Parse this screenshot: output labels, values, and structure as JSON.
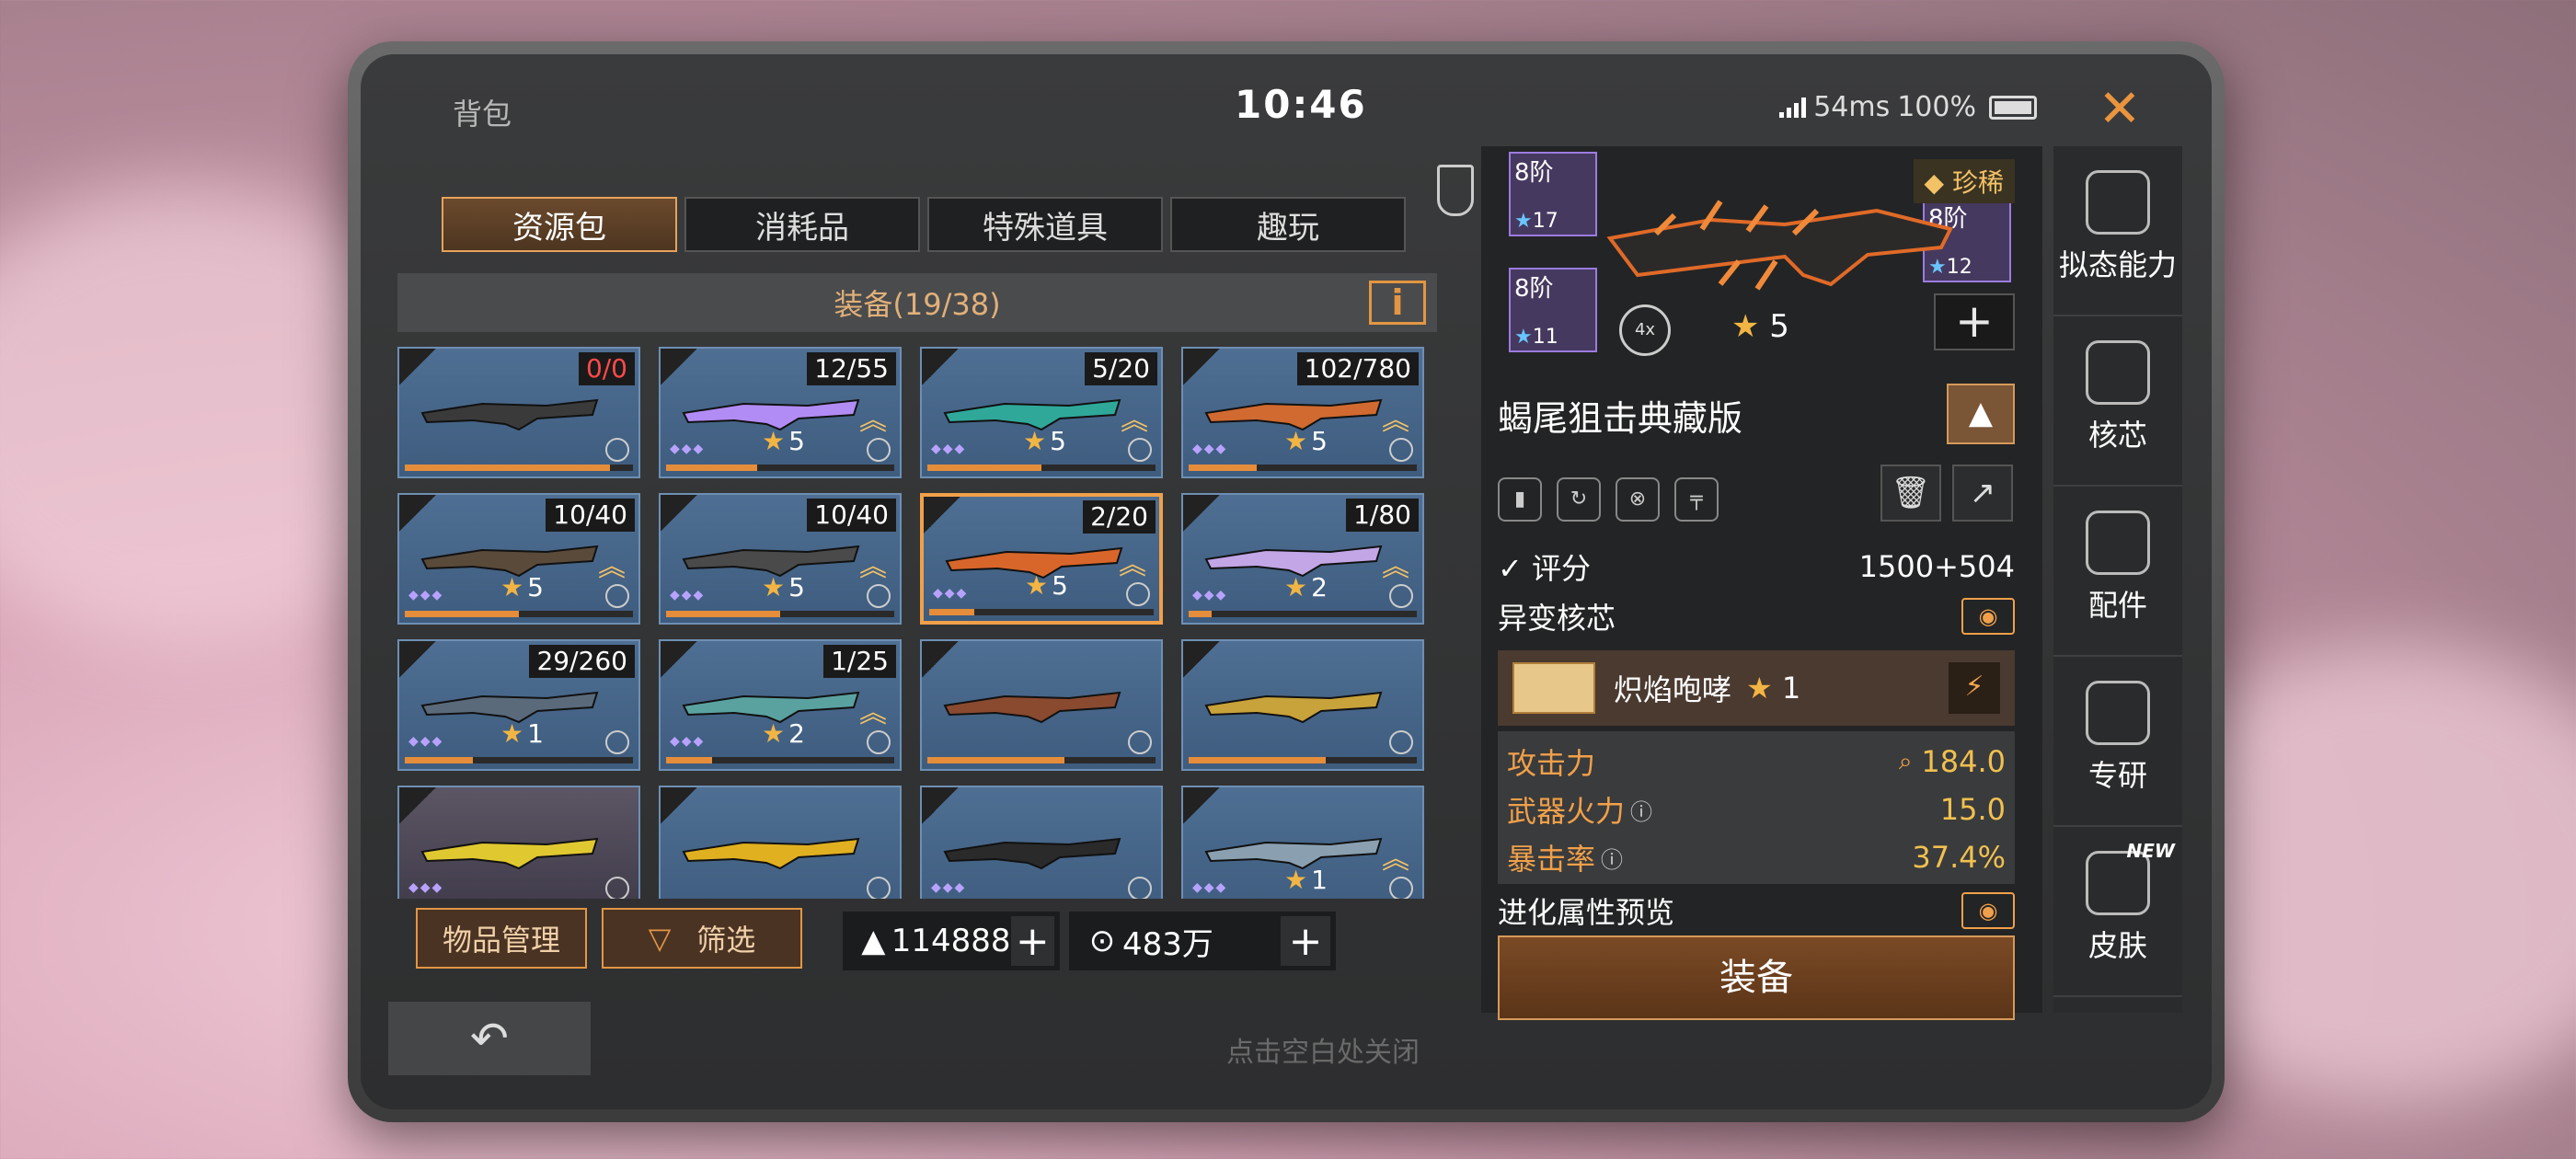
{
  "header": {
    "title": "背包",
    "time": "10:46",
    "ping": "54ms",
    "battery": "100%",
    "close_icon": "close-icon"
  },
  "tabs": [
    {
      "label": "资源包",
      "active": true
    },
    {
      "label": "消耗品",
      "active": false
    },
    {
      "label": "特殊道具",
      "active": false
    },
    {
      "label": "趣玩",
      "active": false
    }
  ],
  "section": {
    "title": "装备(19/38)",
    "info_label": "i"
  },
  "items": [
    {
      "count": "0/0",
      "count_red": true,
      "stars": "",
      "chevron": false,
      "dots": false,
      "progress": 0.9
    },
    {
      "count": "12/55",
      "stars": "5",
      "chevron": true,
      "dots": true,
      "progress": 0.4
    },
    {
      "count": "5/20",
      "stars": "5",
      "chevron": true,
      "dots": true,
      "progress": 0.5
    },
    {
      "count": "102/780",
      "stars": "5",
      "chevron": true,
      "dots": true,
      "progress": 0.3
    },
    {
      "count": "10/40",
      "stars": "5",
      "chevron": true,
      "dots": true,
      "progress": 0.5
    },
    {
      "count": "10/40",
      "stars": "5",
      "chevron": true,
      "dots": true,
      "progress": 0.5
    },
    {
      "count": "2/20",
      "stars": "5",
      "chevron": true,
      "dots": true,
      "progress": 0.2,
      "selected": true
    },
    {
      "count": "1/80",
      "stars": "2",
      "chevron": true,
      "dots": true,
      "progress": 0.1
    },
    {
      "count": "29/260",
      "stars": "1",
      "chevron": false,
      "dots": true,
      "progress": 0.3
    },
    {
      "count": "1/25",
      "stars": "2",
      "chevron": true,
      "dots": true,
      "progress": 0.2
    },
    {
      "count": "",
      "stars": "",
      "chevron": false,
      "dots": false,
      "progress": 0.6
    },
    {
      "count": "",
      "stars": "",
      "chevron": false,
      "dots": false,
      "progress": 0.6
    },
    {
      "count": "",
      "stars": "",
      "chevron": false,
      "dots": true,
      "progress": 0,
      "purple": true
    },
    {
      "count": "",
      "stars": "",
      "chevron": false,
      "dots": false,
      "progress": 0
    },
    {
      "count": "",
      "stars": "",
      "chevron": false,
      "dots": true,
      "progress": 0
    },
    {
      "count": "",
      "stars": "1",
      "chevron": true,
      "dots": true,
      "progress": 0
    }
  ],
  "bottom": {
    "manage_label": "物品管理",
    "filter_label": "筛选",
    "currency1": "114888",
    "currency2": "483万",
    "hint": "点击空白处关闭"
  },
  "detail": {
    "part1": {
      "level": "8阶",
      "stars": "17"
    },
    "part2": {
      "level": "8阶",
      "stars": "11"
    },
    "part3": {
      "level": "8阶",
      "stars": "12"
    },
    "rarity": "珍稀",
    "scope": "4x",
    "weapon_stars": "5",
    "weapon_name": "蝎尾狙击典藏版",
    "score_label": "评分",
    "score_value": "1500+504",
    "mutation_label": "异变核芯",
    "mutation_name": "炽焰咆哮",
    "mutation_stars": "1",
    "stats": [
      {
        "label": "攻击力",
        "value": "184.0"
      },
      {
        "label": "武器火力",
        "value": "15.0"
      },
      {
        "label": "暴击率",
        "value": "37.4%"
      }
    ],
    "evolve_label": "进化属性预览",
    "equip_label": "装备"
  },
  "sidebar": [
    {
      "label": "拟态能力",
      "icon": "mimic-icon"
    },
    {
      "label": "核芯",
      "icon": "core-icon"
    },
    {
      "label": "配件",
      "icon": "parts-icon"
    },
    {
      "label": "专研",
      "icon": "research-icon"
    },
    {
      "label": "皮肤",
      "icon": "skin-icon",
      "badge": "NEW"
    }
  ],
  "colors": {
    "accent": "#e29644",
    "gold": "#f2b544",
    "card_blue": "#4e6f93"
  }
}
